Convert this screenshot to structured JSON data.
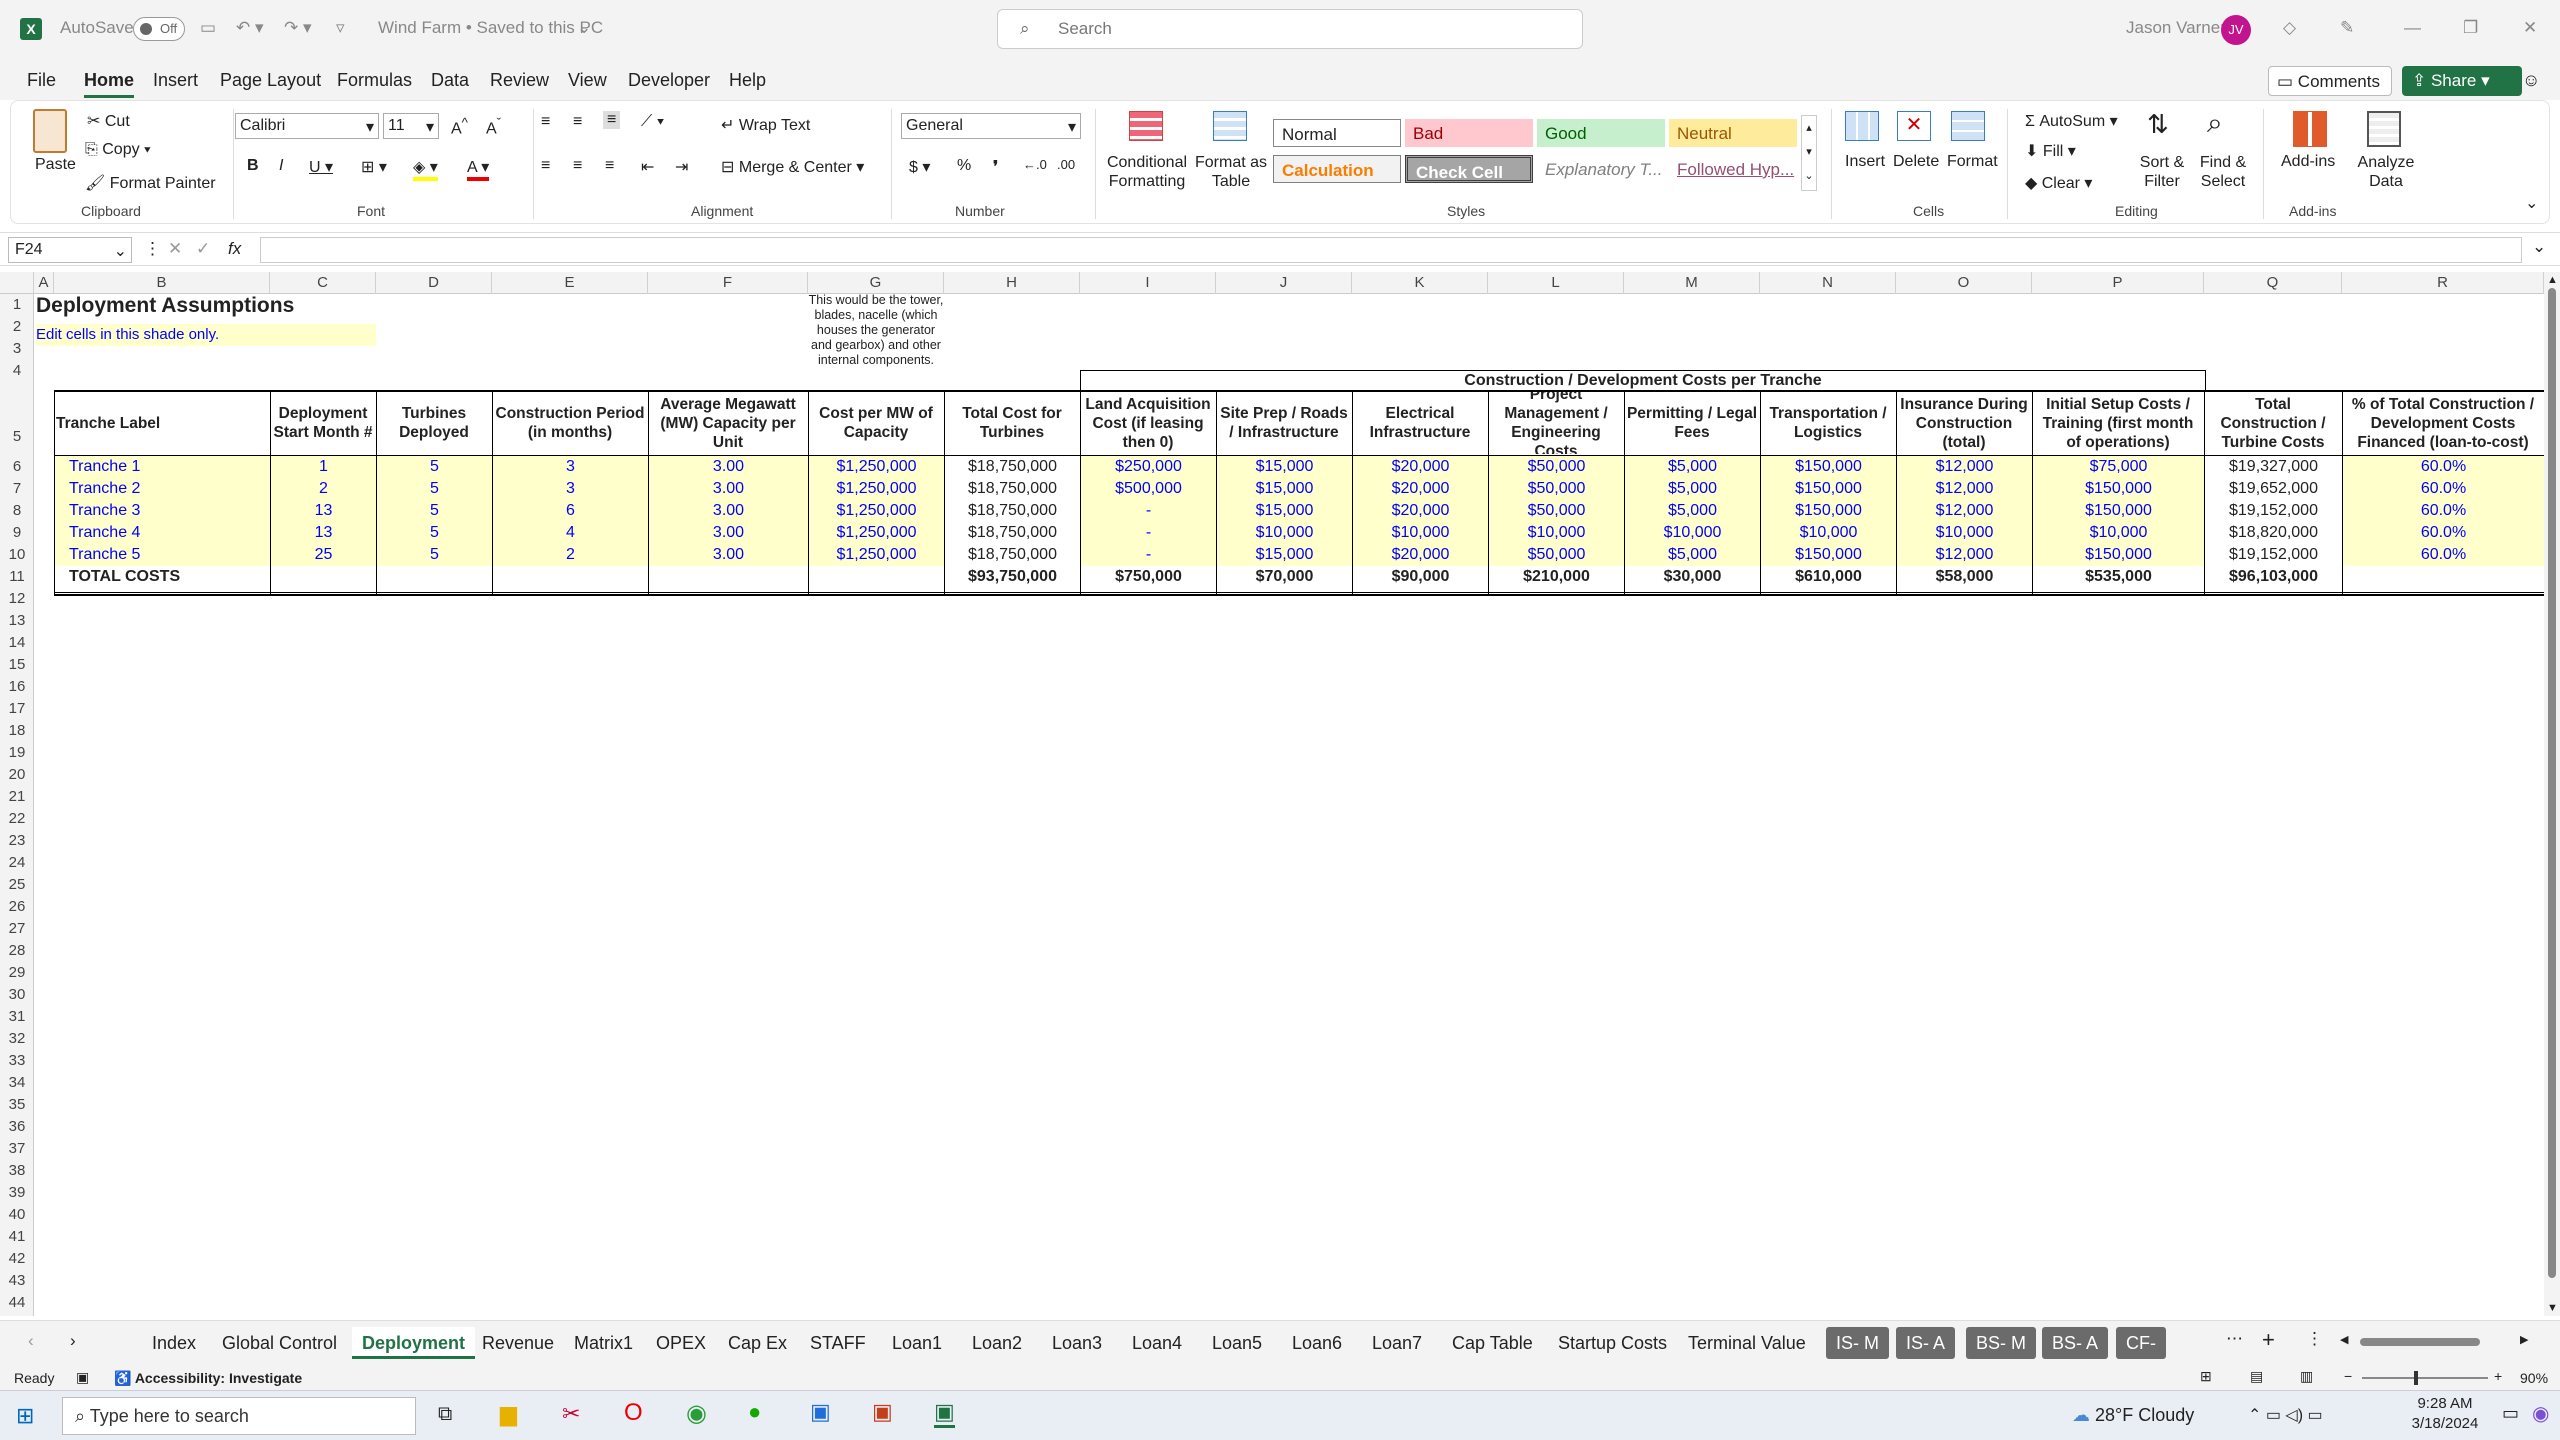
{
  "app": {
    "autosave": "AutoSave",
    "autosave_state": "Off",
    "title": "Wind Farm • Saved to this PC",
    "search_placeholder": "Search",
    "user": "Jason Varner",
    "user_initials": "JV",
    "accent": "#217346"
  },
  "menu": [
    "File",
    "Home",
    "Insert",
    "Page Layout",
    "Formulas",
    "Data",
    "Review",
    "View",
    "Developer",
    "Help"
  ],
  "menu_right": {
    "comments": "Comments",
    "share": "Share"
  },
  "ribbon": {
    "clipboard": {
      "paste": "Paste",
      "cut": "Cut",
      "copy": "Copy",
      "format_painter": "Format Painter",
      "label": "Clipboard"
    },
    "font": {
      "name": "Calibri",
      "size": "11",
      "label": "Font"
    },
    "alignment": {
      "wrap": "Wrap Text",
      "merge": "Merge & Center",
      "label": "Alignment"
    },
    "number": {
      "format": "General",
      "label": "Number"
    },
    "styles": {
      "conditional": "Conditional Formatting",
      "format_table": "Format as Table",
      "normal": "Normal",
      "bad": "Bad",
      "good": "Good",
      "neutral": "Neutral",
      "calculation": "Calculation",
      "check": "Check Cell",
      "explanatory": "Explanatory T...",
      "followed": "Followed Hyp...",
      "label": "Styles"
    },
    "cells": {
      "insert": "Insert",
      "delete": "Delete",
      "format": "Format",
      "label": "Cells"
    },
    "editing": {
      "autosum": "AutoSum",
      "fill": "Fill",
      "clear": "Clear",
      "sort": "Sort & Filter",
      "find": "Find & Select",
      "label": "Editing"
    },
    "addins": {
      "addins": "Add-ins",
      "analyze": "Analyze Data",
      "label": "Add-ins"
    }
  },
  "formula": {
    "namebox": "F24",
    "fx": "fx",
    "value": ""
  },
  "columns": [
    "A",
    "B",
    "C",
    "D",
    "E",
    "F",
    "G",
    "H",
    "I",
    "J",
    "K",
    "L",
    "M",
    "N",
    "O",
    "P",
    "Q",
    "R"
  ],
  "rows": [
    "1",
    "2",
    "3",
    "4",
    "5",
    "6",
    "7",
    "8",
    "9",
    "10",
    "11",
    "12",
    "13",
    "14",
    "15",
    "16",
    "17",
    "18",
    "19",
    "20",
    "21",
    "22",
    "23",
    "24",
    "25",
    "26",
    "27",
    "28",
    "29",
    "30",
    "31",
    "32",
    "33",
    "34",
    "35",
    "36",
    "37",
    "38",
    "39",
    "40",
    "41",
    "42",
    "43",
    "44"
  ],
  "sheet": {
    "title": "Deployment Assumptions",
    "note": "Edit cells in this shade only.",
    "comment": "This would be the tower, blades, nacelle (which houses the generator and gearbox) and other internal components.",
    "group_header": "Construction / Development Costs per Tranche",
    "headers": [
      "Tranche Label",
      "Deployment Start Month #",
      "Turbines Deployed",
      "Construction Period (in months)",
      "Average Megawatt (MW) Capacity per Unit",
      "Cost per MW of Capacity",
      "Total Cost for Turbines",
      "Land Acquisition Cost (if leasing then 0)",
      "Site Prep / Roads / Infrastructure",
      "Electrical Infrastructure",
      "Project Management / Engineering Costs",
      "Permitting / Legal Fees",
      "Transportation / Logistics",
      "Insurance During Construction (total)",
      "Initial Setup Costs / Training (first month of operations)",
      "Total Construction / Turbine Costs",
      "% of Total Construction / Development Costs Financed (loan-to-cost)"
    ],
    "header_sub": "(in months)",
    "data": [
      [
        "Tranche 1",
        "1",
        "5",
        "3",
        "3.00",
        "$1,250,000",
        "$18,750,000",
        "$250,000",
        "$15,000",
        "$20,000",
        "$50,000",
        "$5,000",
        "$150,000",
        "$12,000",
        "$75,000",
        "$19,327,000",
        "60.0%"
      ],
      [
        "Tranche 2",
        "2",
        "5",
        "3",
        "3.00",
        "$1,250,000",
        "$18,750,000",
        "$500,000",
        "$15,000",
        "$20,000",
        "$50,000",
        "$5,000",
        "$150,000",
        "$12,000",
        "$150,000",
        "$19,652,000",
        "60.0%"
      ],
      [
        "Tranche 3",
        "13",
        "5",
        "6",
        "3.00",
        "$1,250,000",
        "$18,750,000",
        "-",
        "$15,000",
        "$20,000",
        "$50,000",
        "$5,000",
        "$150,000",
        "$12,000",
        "$150,000",
        "$19,152,000",
        "60.0%"
      ],
      [
        "Tranche 4",
        "13",
        "5",
        "4",
        "3.00",
        "$1,250,000",
        "$18,750,000",
        "-",
        "$10,000",
        "$10,000",
        "$10,000",
        "$10,000",
        "$10,000",
        "$10,000",
        "$10,000",
        "$18,820,000",
        "60.0%"
      ],
      [
        "Tranche 5",
        "25",
        "5",
        "2",
        "3.00",
        "$1,250,000",
        "$18,750,000",
        "-",
        "$15,000",
        "$20,000",
        "$50,000",
        "$5,000",
        "$150,000",
        "$12,000",
        "$150,000",
        "$19,152,000",
        "60.0%"
      ]
    ],
    "totals": [
      "TOTAL COSTS",
      "$93,750,000",
      "$750,000",
      "$70,000",
      "$90,000",
      "$210,000",
      "$30,000",
      "$610,000",
      "$58,000",
      "$535,000",
      "$96,103,000"
    ]
  },
  "tabs": [
    "Index",
    "Global Control",
    "Deployment",
    "Revenue",
    "Matrix1",
    "OPEX",
    "Cap Ex",
    "STAFF",
    "Loan1",
    "Loan2",
    "Loan3",
    "Loan4",
    "Loan5",
    "Loan6",
    "Loan7",
    "Cap Table",
    "Startup Costs",
    "Terminal Value",
    "IS- M",
    "IS- A",
    "BS- M",
    "BS- A",
    "CF- M"
  ],
  "status": {
    "ready": "Ready",
    "accessibility": "Accessibility: Investigate",
    "zoom": "90%"
  },
  "taskbar": {
    "search": "Type here to search",
    "weather": "28°F  Cloudy",
    "time": "9:28 AM",
    "date": "3/18/2024"
  }
}
